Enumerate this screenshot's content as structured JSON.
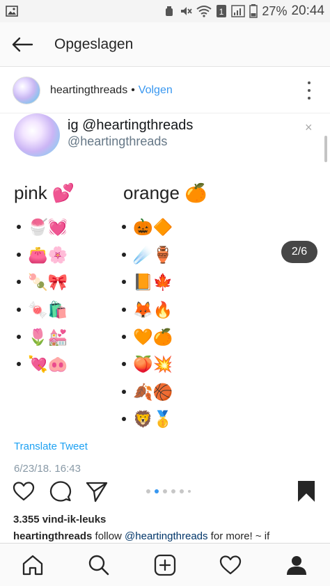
{
  "statusbar": {
    "battery": "27%",
    "time": "20:44",
    "sim_badge": "1",
    "icons": [
      "image-icon",
      "alarm-icon",
      "mute-icon",
      "wifi-icon",
      "sim-icon",
      "signal-icon",
      "battery-icon"
    ]
  },
  "header": {
    "title": "Opgeslagen",
    "back_icon": "arrow-left-icon"
  },
  "post": {
    "username": "heartingthreads",
    "separator": "•",
    "follow_label": "Volgen",
    "more_icon": "more-vertical-icon"
  },
  "image": {
    "tweet_name": "ig @heartingthreads",
    "tweet_handle": "@heartingthreads",
    "counter": "2/6",
    "close": "×",
    "pink": {
      "title": "pink 💕",
      "items": [
        "🍧💓",
        "👛🌸",
        "🍡🎀",
        "🍬🛍️",
        "🌷💒",
        "💘🐽"
      ]
    },
    "orange": {
      "title": "orange 🍊",
      "items": [
        "🎃🔶",
        "☄️🏺",
        "📙🍁",
        "🦊🔥",
        "🧡🍊",
        "🍑💥",
        "🍂🏀",
        "🦁🥇"
      ]
    },
    "translate": "Translate Tweet",
    "date": "6/23/18, 16:43"
  },
  "actions": {
    "icons": [
      "heart-icon",
      "comment-icon",
      "share-icon",
      "bookmark-icon"
    ],
    "carousel_total": 6,
    "carousel_active": 2
  },
  "likes": "3.355 vind-ik-leuks",
  "caption": {
    "username": "heartingthreads",
    "text_before": " follow ",
    "mention": "@heartingthreads",
    "text_after": " for more! ~ if"
  },
  "bottomnav": {
    "icons": [
      "home-icon",
      "search-icon",
      "add-post-icon",
      "activity-heart-icon",
      "profile-icon"
    ]
  },
  "colors": {
    "link_blue": "#3897f0",
    "twitter_blue": "#1da1f2",
    "counter_bg": "#262626"
  }
}
